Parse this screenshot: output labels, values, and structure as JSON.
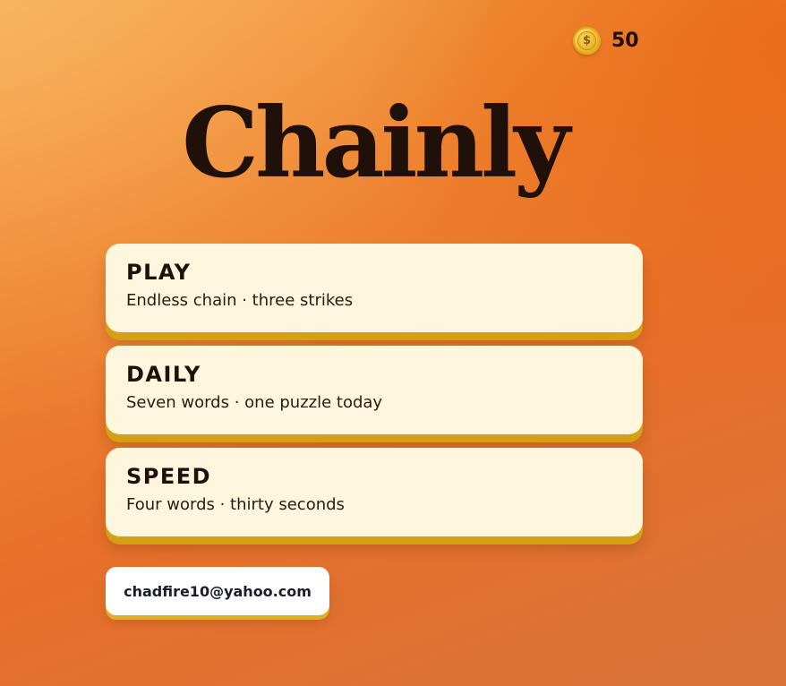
{
  "header": {
    "coin_icon": "dollar-coin-icon",
    "coin_symbol": "$",
    "coin_count": "50"
  },
  "app": {
    "title": "Chainly"
  },
  "modes": [
    {
      "title": "PLAY",
      "description": "Endless chain · three strikes"
    },
    {
      "title": "DAILY",
      "description": "Seven words · one puzzle today"
    },
    {
      "title": "SPEED",
      "description": "Four words · thirty seconds"
    }
  ],
  "account": {
    "email": "chadfire10@yahoo.com"
  },
  "colors": {
    "background_top": "#f4a54a",
    "background_bottom": "#d9733a",
    "card_background": "#fef6dd",
    "card_shadow": "#d4a014",
    "text_dark": "#1f110a"
  }
}
